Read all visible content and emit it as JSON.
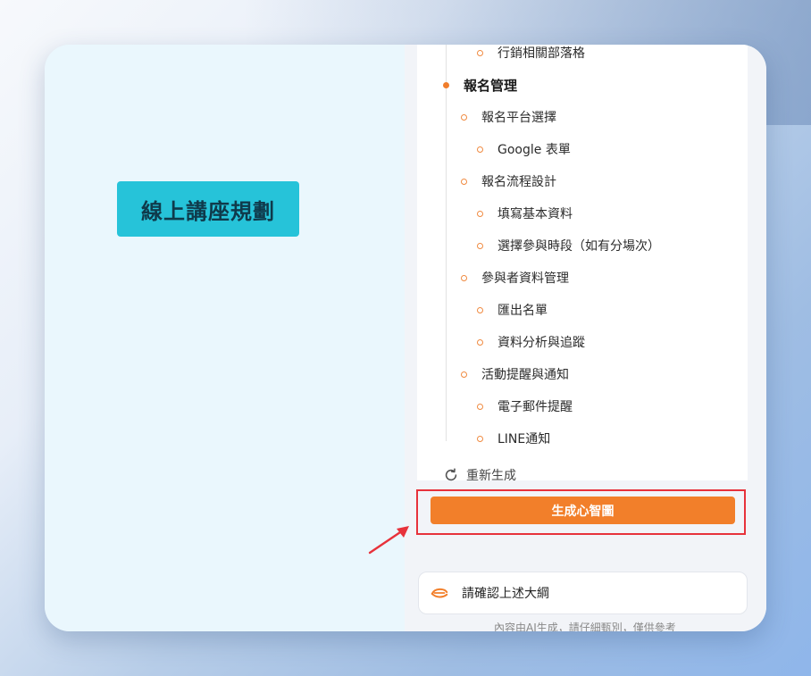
{
  "mindmap": {
    "root_title": "線上講座規劃"
  },
  "outline": {
    "items": [
      {
        "level": 2,
        "label": "行銷相關部落格"
      },
      {
        "level": 0,
        "label": "報名管理"
      },
      {
        "level": 1,
        "label": "報名平台選擇"
      },
      {
        "level": 2,
        "label": "Google 表單"
      },
      {
        "level": 1,
        "label": "報名流程設計"
      },
      {
        "level": 2,
        "label": "填寫基本資料"
      },
      {
        "level": 2,
        "label": "選擇參與時段（如有分場次）"
      },
      {
        "level": 1,
        "label": "參與者資料管理"
      },
      {
        "level": 2,
        "label": "匯出名單"
      },
      {
        "level": 2,
        "label": "資料分析與追蹤"
      },
      {
        "level": 1,
        "label": "活動提醒與通知"
      },
      {
        "level": 2,
        "label": "電子郵件提醒"
      },
      {
        "level": 2,
        "label": "LINE通知"
      }
    ]
  },
  "actions": {
    "regenerate_label": "重新生成",
    "generate_mindmap_label": "生成心智圖"
  },
  "confirm": {
    "label": "請確認上述大綱"
  },
  "footer": {
    "disclaimer": "內容由AI生成，請仔細甄別，僅供參考"
  },
  "colors": {
    "accent": "#f27f2a",
    "highlight_border": "#e7323b",
    "root_node": "#26c3d9"
  },
  "icons": {
    "regenerate": "refresh-icon",
    "confirm": "ai-logo-icon",
    "annotation": "red-arrow-icon"
  }
}
